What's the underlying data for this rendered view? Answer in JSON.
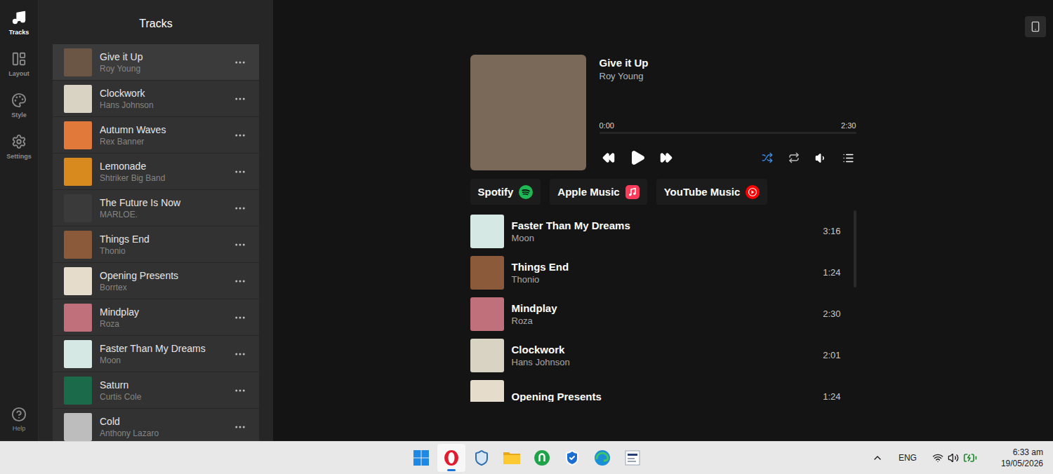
{
  "rail": {
    "items": [
      {
        "label": "Tracks",
        "selected": true
      },
      {
        "label": "Layout",
        "selected": false
      },
      {
        "label": "Style",
        "selected": false
      },
      {
        "label": "Settings",
        "selected": false
      }
    ],
    "help": "Help"
  },
  "tracks_panel": {
    "title": "Tracks",
    "items": [
      {
        "title": "Give it Up",
        "artist": "Roy Young",
        "selected": true,
        "color": "#6b5646"
      },
      {
        "title": "Clockwork",
        "artist": "Hans Johnson",
        "selected": false,
        "color": "#d9d3c4"
      },
      {
        "title": "Autumn Waves",
        "artist": "Rex Banner",
        "selected": false,
        "color": "#e0793a"
      },
      {
        "title": "Lemonade",
        "artist": "Shtriker Big Band",
        "selected": false,
        "color": "#d98a1f"
      },
      {
        "title": "The Future Is Now",
        "artist": "MARLOE.",
        "selected": false,
        "color": "#3a3a3a"
      },
      {
        "title": "Things End",
        "artist": "Thonio",
        "selected": false,
        "color": "#8a5a3a"
      },
      {
        "title": "Opening Presents",
        "artist": "Borrtex",
        "selected": false,
        "color": "#e6dccb"
      },
      {
        "title": "Mindplay",
        "artist": "Roza",
        "selected": false,
        "color": "#c0707a"
      },
      {
        "title": "Faster Than My Dreams",
        "artist": "Moon",
        "selected": false,
        "color": "#d6e8e3"
      },
      {
        "title": "Saturn",
        "artist": "Curtis Cole",
        "selected": false,
        "color": "#1b6a4a"
      },
      {
        "title": "Cold",
        "artist": "Anthony Lazaro",
        "selected": false,
        "color": "#bdbdbd"
      }
    ]
  },
  "player": {
    "title": "Give it Up",
    "artist": "Roy Young",
    "elapsed": "0:00",
    "duration": "2:30",
    "level": 0,
    "shuffle": true,
    "repeat": false
  },
  "services": [
    {
      "name": "Spotify",
      "kind": "spotify"
    },
    {
      "name": "Apple Music",
      "kind": "apple"
    },
    {
      "name": "YouTube Music",
      "kind": "youtube"
    }
  ],
  "queue": [
    {
      "title": "Faster Than My Dreams",
      "artist": "Moon",
      "duration": "3:16",
      "color": "#d6e8e3"
    },
    {
      "title": "Things End",
      "artist": "Thonio",
      "duration": "1:24",
      "color": "#8a5a3a"
    },
    {
      "title": "Mindplay",
      "artist": "Roza",
      "duration": "2:30",
      "color": "#c0707a"
    },
    {
      "title": "Clockwork",
      "artist": "Hans Johnson",
      "duration": "2:01",
      "color": "#d9d3c4"
    },
    {
      "title": "Opening Presents",
      "artist": "",
      "duration": "1:24",
      "color": "#e6dccb"
    }
  ],
  "taskbar": {
    "apps": [
      {
        "kind": "windows",
        "selected": false
      },
      {
        "kind": "opera",
        "selected": true
      },
      {
        "kind": "guard",
        "selected": false
      },
      {
        "kind": "folder",
        "selected": false
      },
      {
        "kind": "greenapp",
        "selected": false
      },
      {
        "kind": "defender",
        "selected": false
      },
      {
        "kind": "edge",
        "selected": false
      },
      {
        "kind": "docapp",
        "selected": false
      }
    ],
    "language": "ENG",
    "time": "6:33 am",
    "date": "19/05/2026"
  }
}
